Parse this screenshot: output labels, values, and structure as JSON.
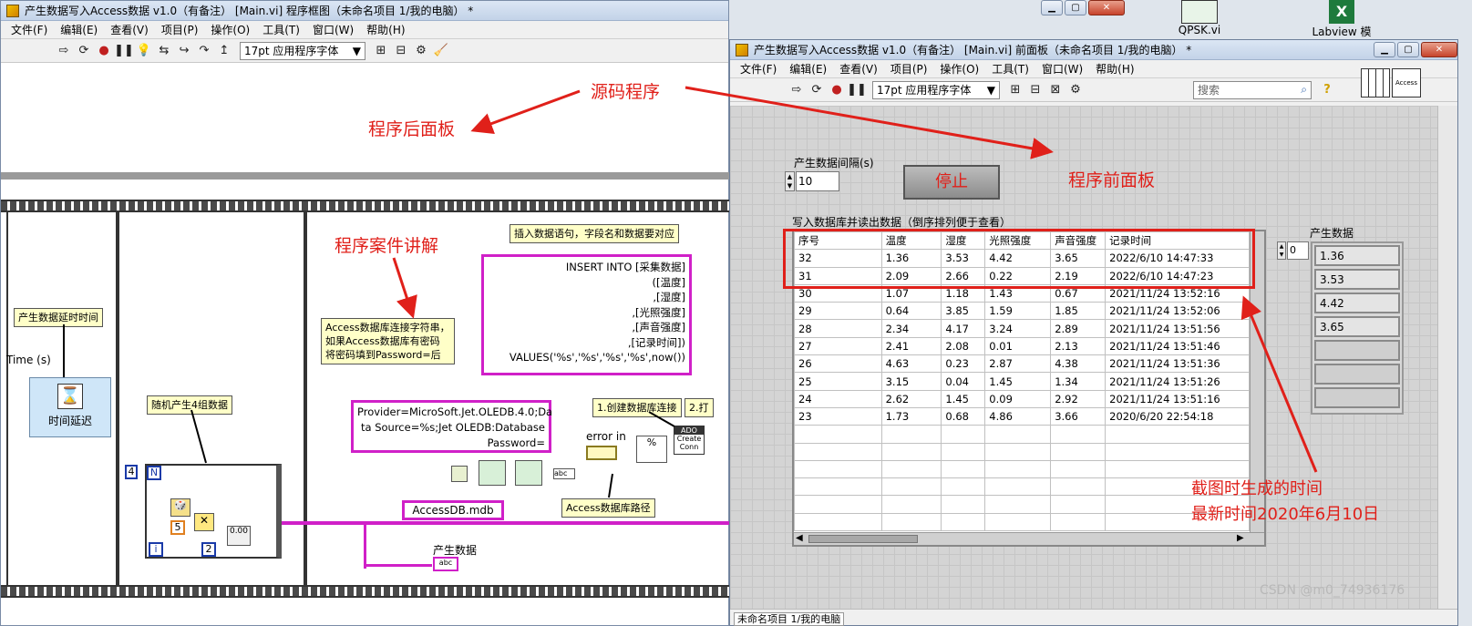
{
  "block_diagram": {
    "title": "产生数据写入Access数据 v1.0（有备注） [Main.vi] 程序框图（未命名项目 1/我的电脑） *",
    "menu": [
      "文件(F)",
      "编辑(E)",
      "查看(V)",
      "项目(P)",
      "操作(O)",
      "工具(T)",
      "窗口(W)",
      "帮助(H)"
    ],
    "font": "17pt 应用程序字体",
    "labels": {
      "time_s": "Time (s)",
      "delay": "时间延迟",
      "n": "N",
      "four": "4",
      "five": "5",
      "two": "2",
      "i": "i",
      "error_in": "error in",
      "ado": "ADO",
      "create_conn": "Create Conn",
      "mdb": "AccessDB.mdb",
      "gen_data": "产生数据"
    },
    "notes": {
      "delay_note": "产生数据延时时间",
      "random_note": "随机产生4组数据",
      "conn_note1": "Access数据库连接字符串，",
      "conn_note2": "如果Access数据库有密码",
      "conn_note3": "将密码填到Password=后",
      "insert_note": "插入数据语句，字段名和数据要对应",
      "create_note": "1.创建数据库连接",
      "open_note": "2.打",
      "path_note": "Access数据库路径"
    },
    "sql": [
      "INSERT INTO [采集数据]",
      "([温度]",
      ",[湿度]",
      ",[光照强度]",
      ",[声音强度]",
      ",[记录时间])",
      "VALUES('%s','%s','%s','%s',now())"
    ],
    "conn_string": [
      "Provider=MicroSoft.Jet.OLEDB.4.0;Da",
      "ta Source=%s;Jet OLEDB:Database",
      "Password="
    ]
  },
  "annotations": {
    "source": "源码程序",
    "back_panel": "程序后面板",
    "case_explain": "程序案件讲解",
    "front_panel": "程序前面板",
    "time_note1": "截图时生成的时间",
    "time_note2": "最新时间2020年6月10日"
  },
  "desktop": {
    "icon1": "QPSK.vi",
    "icon2": "Labview 模"
  },
  "front_panel": {
    "title": "产生数据写入Access数据 v1.0（有备注） [Main.vi] 前面板（未命名项目 1/我的电脑） *",
    "menu": [
      "文件(F)",
      "编辑(E)",
      "查看(V)",
      "项目(P)",
      "操作(O)",
      "工具(T)",
      "窗口(W)",
      "帮助(H)"
    ],
    "font": "17pt 应用程序字体",
    "search_placeholder": "搜索",
    "access_icon": "Access",
    "interval_label": "产生数据间隔(s)",
    "interval_value": "10",
    "stop_label": "停止",
    "table_label": "写入数据库并读出数据（倒序排列便于查看）",
    "table_headers": [
      "序号",
      "温度",
      "湿度",
      "光照强度",
      "声音强度",
      "记录时间"
    ],
    "table_rows": [
      [
        "32",
        "1.36",
        "3.53",
        "4.42",
        "3.65",
        "2022/6/10 14:47:33"
      ],
      [
        "31",
        "2.09",
        "2.66",
        "0.22",
        "2.19",
        "2022/6/10 14:47:23"
      ],
      [
        "30",
        "1.07",
        "1.18",
        "1.43",
        "0.67",
        "2021/11/24 13:52:16"
      ],
      [
        "29",
        "0.64",
        "3.85",
        "1.59",
        "1.85",
        "2021/11/24 13:52:06"
      ],
      [
        "28",
        "2.34",
        "4.17",
        "3.24",
        "2.89",
        "2021/11/24 13:51:56"
      ],
      [
        "27",
        "2.41",
        "2.08",
        "0.01",
        "2.13",
        "2021/11/24 13:51:46"
      ],
      [
        "26",
        "4.63",
        "0.23",
        "2.87",
        "4.38",
        "2021/11/24 13:51:36"
      ],
      [
        "25",
        "3.15",
        "0.04",
        "1.45",
        "1.34",
        "2021/11/24 13:51:26"
      ],
      [
        "24",
        "2.62",
        "1.45",
        "0.09",
        "2.92",
        "2021/11/24 13:51:16"
      ],
      [
        "23",
        "1.73",
        "0.68",
        "4.86",
        "3.66",
        "2020/6/20 22:54:18"
      ]
    ],
    "array_label": "产生数据",
    "array_index": "0",
    "array_values": [
      "1.36",
      "3.53",
      "4.42",
      "3.65"
    ],
    "status": "未命名项目 1/我的电脑"
  },
  "watermark": "CSDN @m0_74936176"
}
